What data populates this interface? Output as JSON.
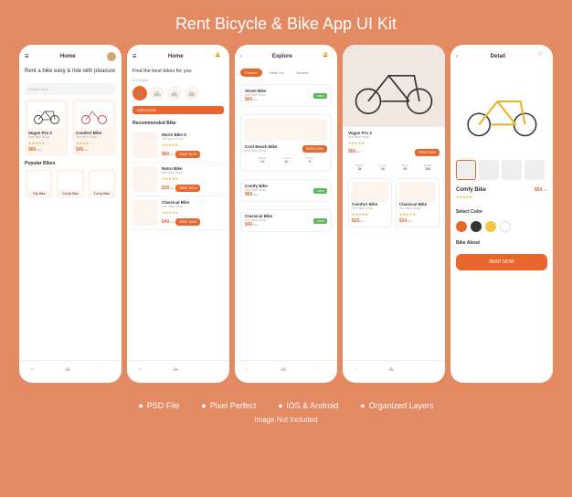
{
  "title": "Rent Bicycle & Bike App UI Kit",
  "features": [
    "PSD File",
    "Pixel Perfect",
    "iOS & Android",
    "Organized Layers"
  ],
  "disclaimer": "Image Not Included",
  "colors": {
    "accent": "#e8672c",
    "bg": "#e38a63",
    "star": "#f5a623",
    "open": "#5cb85c"
  },
  "screen1": {
    "header": "Home",
    "hero": "Rent a bike easy & ride with pleasure",
    "search_placeholder": "Search here",
    "featured": [
      {
        "name": "Vogan Pro 2",
        "shop": "Kun Bike Shop",
        "rating": 5,
        "price": "$60",
        "per": "/day"
      },
      {
        "name": "Comfort Bike",
        "shop": "Kun Bike Shop",
        "rating": 4,
        "price": "$45",
        "per": "/day"
      }
    ],
    "popular_title": "Popular Bikes",
    "popular": [
      {
        "name": "City Bike"
      },
      {
        "name": "Comfy Bike"
      },
      {
        "name": "Funny Bike"
      }
    ]
  },
  "screen2": {
    "header": "Home",
    "hero": "Find the best bikes for you",
    "sub": "870 bicycle",
    "discover": "DISCOVER",
    "sec_title": "Recommended Bike",
    "list": [
      {
        "name": "Morin Bike II",
        "sub": "300 year in use",
        "rating": 5,
        "price": "$80",
        "per": "/day",
        "cta": "RENT NOW"
      },
      {
        "name": "Retro Bike",
        "sub": "Kun Bike Shop",
        "rating": 5,
        "price": "$30",
        "per": "/day",
        "cta": "RENT NOW"
      },
      {
        "name": "Classical Bike",
        "sub": "Kun Bike Shop",
        "rating": 5,
        "price": "$40",
        "per": "/day",
        "cta": "RENT NOW"
      }
    ]
  },
  "screen3": {
    "header": "Explore",
    "pills": [
      "Popular",
      "Near You",
      "Newest"
    ],
    "cards": [
      {
        "name": "Street Bike",
        "shop": "Kun Bike Shop",
        "price": "$60",
        "per": "/day",
        "badge": "OPEN"
      },
      {
        "name": "Cool Beach Bike",
        "shop": "Kun Bike Shop",
        "cta": "RENT NOW",
        "specs": [
          {
            "l": "Ready",
            "v": "24"
          },
          {
            "l": "In use",
            "v": "42"
          },
          {
            "l": "Broke",
            "v": "5"
          }
        ]
      },
      {
        "name": "Comfy Bike",
        "shop": "Kun Bike Shop",
        "price": "$60",
        "per": "/day",
        "badge": "OPEN"
      },
      {
        "name": "Classical Bike",
        "shop": "Kun Bike Shop",
        "price": "$40",
        "per": "/day",
        "badge": "OPEN"
      }
    ]
  },
  "screen4": {
    "name": "Vogan Pro 2",
    "shop": "Kun Bike Shop",
    "rating": 5,
    "price": "$60",
    "per": "/day",
    "cta": "RENT NOW",
    "specs": [
      {
        "l": "Ready",
        "v": "34"
      },
      {
        "l": "In use",
        "v": "26"
      },
      {
        "l": "Broke",
        "v": "63"
      },
      {
        "l": "Ready",
        "v": "300"
      }
    ],
    "cards": [
      {
        "name": "Comfort Bike",
        "shop": "Kun Bike Shop",
        "price": "$25",
        "per": "/day"
      },
      {
        "name": "Classical Bike",
        "shop": "Kun Bike Shop",
        "price": "$24",
        "per": "/day"
      }
    ]
  },
  "screen5": {
    "header": "Detail",
    "name": "Comfy Bike",
    "rating": 5,
    "price": "$54",
    "per": "/day",
    "select_color": "Select Color",
    "colors": [
      "#e8672c",
      "#333333",
      "#f5c842",
      "#ffffff"
    ],
    "about_title": "Bike About",
    "about": "",
    "cta": "RENT NOW"
  }
}
